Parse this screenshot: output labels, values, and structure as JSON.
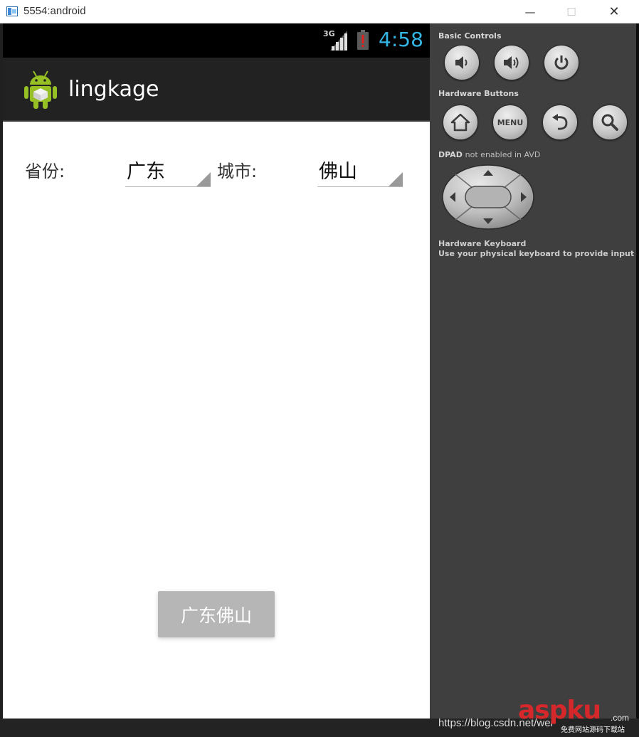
{
  "window": {
    "title": "5554:android",
    "minimize_glyph": "—",
    "maximize_glyph": "☐",
    "close_glyph": "✕"
  },
  "statusbar": {
    "network": "3G",
    "time": "4:58",
    "colors": {
      "clock": "#33b5e5",
      "battery_warning": "#cc0000"
    }
  },
  "actionbar": {
    "title": "lingkage",
    "icon": "android-robot-icon"
  },
  "form": {
    "province_label": "省份:",
    "province_value": "广东",
    "city_label": "城市:",
    "city_value": "佛山",
    "result_button": "广东佛山"
  },
  "controls": {
    "basic_title": "Basic Controls",
    "basic_buttons": [
      "volume-down-icon",
      "volume-up-icon",
      "power-icon"
    ],
    "hardware_title": "Hardware Buttons",
    "hardware_buttons": [
      "home-icon",
      "menu-button",
      "back-icon",
      "search-icon"
    ],
    "menu_label": "MENU",
    "dpad_title": "DPAD",
    "dpad_note": "not enabled in AVD",
    "keyboard_title": "Hardware Keyboard",
    "keyboard_desc": "Use your physical keyboard to provide input"
  },
  "footer": {
    "url": "https://blog.csdn.net/wei",
    "watermark": "aspku",
    "watermark_suffix": ".com",
    "watermark_sub": "免费网站源码下载站"
  }
}
